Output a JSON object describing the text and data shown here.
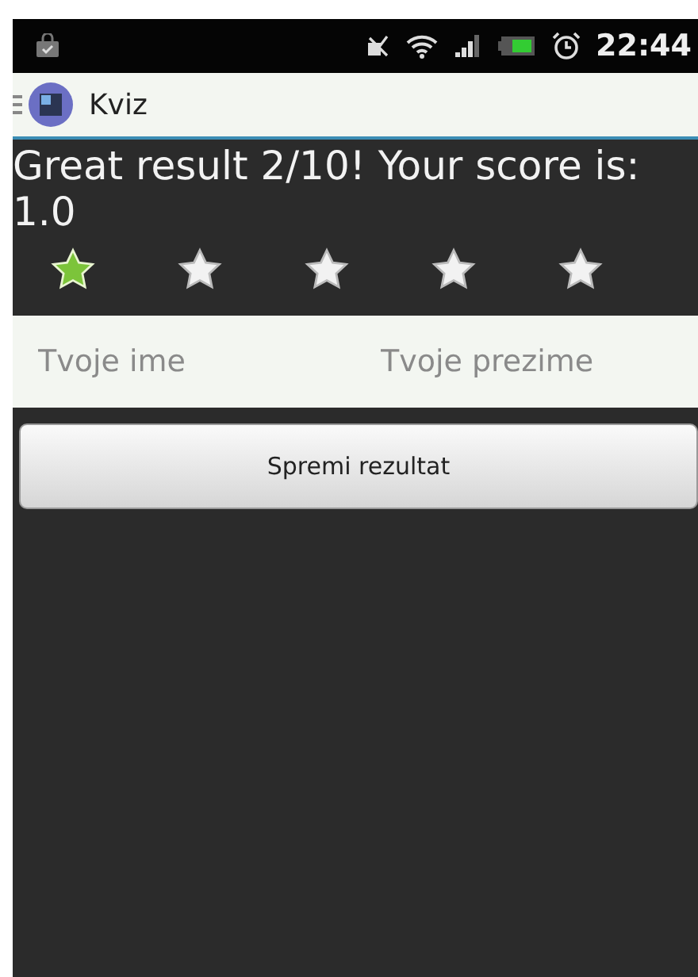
{
  "status_bar": {
    "time": "22:44"
  },
  "action_bar": {
    "title": "Kviz"
  },
  "result": {
    "message": "Great result 2/10! Your score is: 1.0"
  },
  "rating": {
    "stars": 1
  },
  "fields": [
    {
      "placeholder": "Tvoje ime"
    },
    {
      "placeholder": "Tvoje prezime"
    }
  ],
  "buttons": [
    {
      "label": "Spremi rezultat"
    }
  ]
}
